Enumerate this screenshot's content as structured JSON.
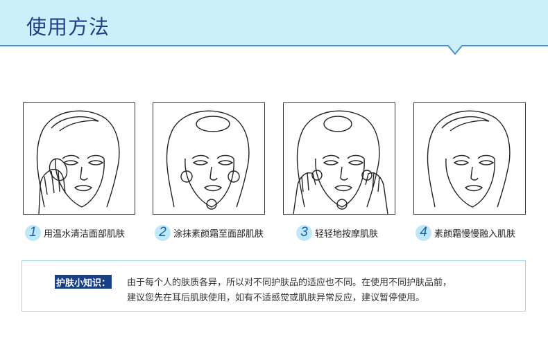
{
  "header": {
    "title": "使用方法",
    "bg_color": "#cdeefb",
    "line_color": "#4a8fd6"
  },
  "steps": [
    {
      "number": "1",
      "text": "用温水清洁面部肌肤",
      "image": "face-washing-with-hands"
    },
    {
      "number": "2",
      "text": "涂抹素颜霜至面部肌肤",
      "image": "face-with-cream-dots"
    },
    {
      "number": "3",
      "text": "轻轻地按摩肌肤",
      "image": "face-massaging-with-hands"
    },
    {
      "number": "4",
      "text": "素颜霜慢慢融入肌肤",
      "image": "face-clean-result"
    }
  ],
  "tips": {
    "label": "护肤小知识：",
    "line1": "由于每个人的肤质各异，所以对不同护肤品的适应也不同。在使用不同护肤品前，",
    "line2": "建议您先在耳后肌肤使用，如有不适感觉或肌肤异常反应，建议暂停使用。"
  }
}
